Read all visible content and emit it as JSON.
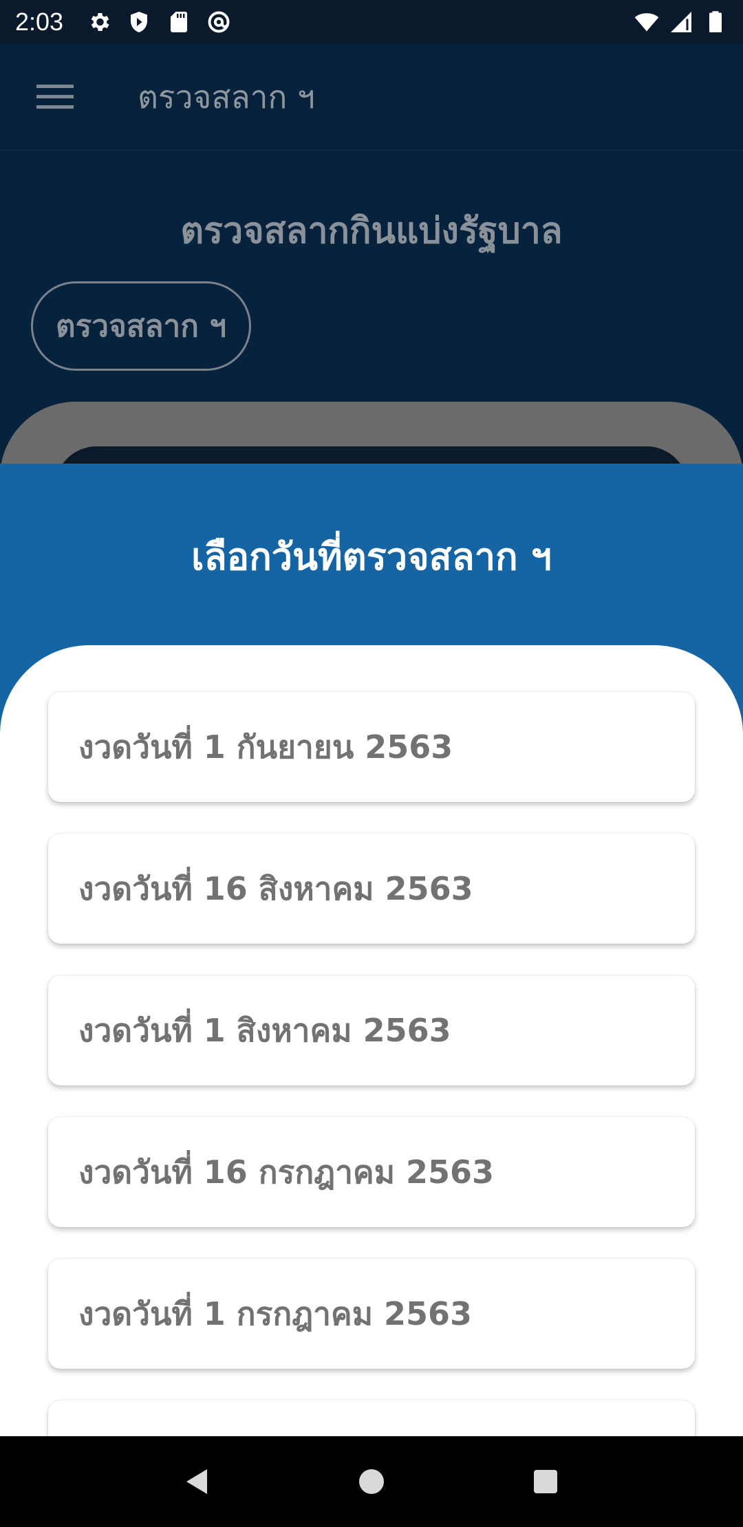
{
  "status_bar": {
    "time": "2:03",
    "left_icons": [
      "settings-icon",
      "shield-icon",
      "sd-card-icon",
      "at-sign-icon"
    ],
    "right_icons": [
      "wifi-icon",
      "cellular-signal-icon",
      "battery-icon"
    ]
  },
  "app_bar": {
    "title": "ตรวจสลาก ฯ",
    "menu_icon": "hamburger-menu-icon"
  },
  "main": {
    "heading": "ตรวจสลากกินแบ่งรัฐบาล",
    "check_button_label": "ตรวจสลาก ฯ"
  },
  "sheet": {
    "title": "เลือกวันที่ตรวจสลาก ฯ",
    "draws": [
      {
        "label": "งวดวันที่ 1 กันยายน 2563"
      },
      {
        "label": "งวดวันที่ 16 สิงหาคม 2563"
      },
      {
        "label": "งวดวันที่ 1 สิงหาคม 2563"
      },
      {
        "label": "งวดวันที่ 16 กรกฎาคม 2563"
      },
      {
        "label": "งวดวันที่ 1 กรกฎาคม 2563"
      },
      {
        "label": ""
      }
    ]
  },
  "nav_bar": {
    "buttons": [
      "back-icon",
      "home-icon",
      "recents-icon"
    ]
  },
  "colors": {
    "sheet_header": "#1565a4",
    "scrim_app_bar": "#08223c",
    "item_text": "#727272"
  }
}
